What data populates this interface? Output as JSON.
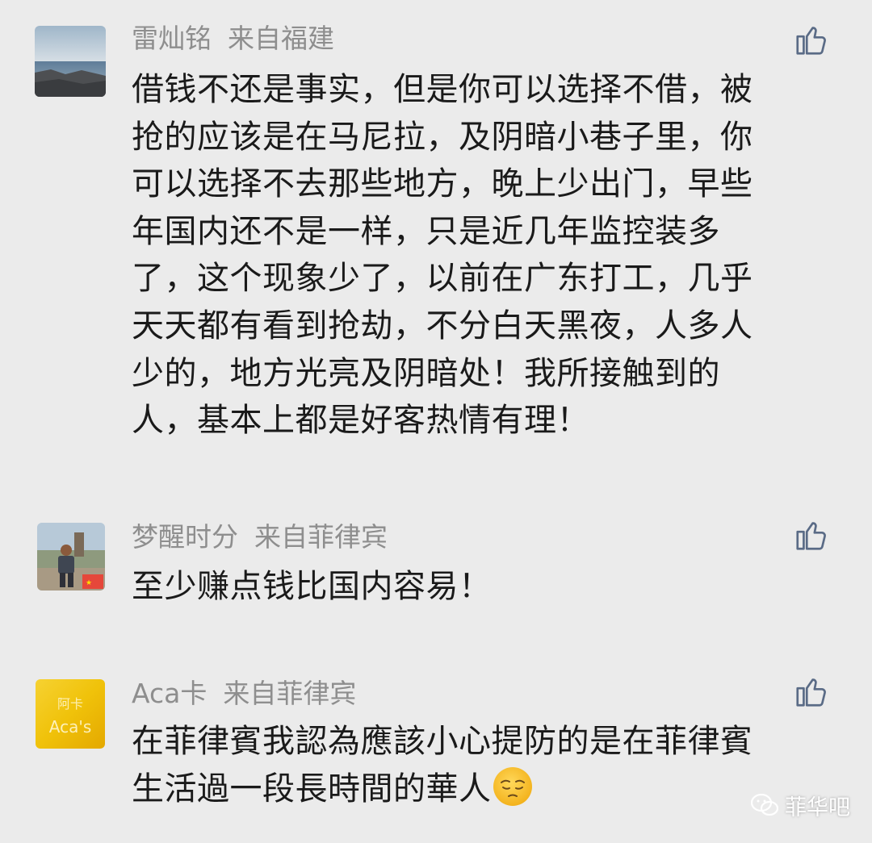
{
  "comments": [
    {
      "name": "雷灿铭",
      "location": "来自福建",
      "lines": [
        "借钱不还是事实，但是你可以选择不借，被",
        "抢的应该是在马尼拉，及阴暗小巷子里，你",
        "可以选择不去那些地方，晚上少出门，早些",
        "年国内还不是一样，只是近几年监控装多",
        "了，这个现象少了，以前在广东打工，几乎",
        "天天都有看到抢劫，不分白天黑夜，人多人",
        "少的，地方光亮及阴暗处！我所接触到的",
        "人，基本上都是好客热情有理！"
      ],
      "avatar_icon": "seaside-photo-avatar",
      "like_icon": "thumbs-up-icon"
    },
    {
      "name": "梦醒时分",
      "location": "来自菲律宾",
      "lines": [
        "至少赚点钱比国内容易！"
      ],
      "avatar_icon": "person-photo-avatar",
      "like_icon": "thumbs-up-icon"
    },
    {
      "name": "Aca卡",
      "location": "来自菲律宾",
      "lines": [
        "在菲律賓我認為應該小心提防的是在菲律賓",
        "生活過一段長時間的華人"
      ],
      "emoji": "pensive-face-emoji",
      "avatar_text_top": "阿卡",
      "avatar_text_bottom": "Aca's",
      "avatar_icon": "gold-text-avatar",
      "like_icon": "thumbs-up-icon"
    }
  ],
  "watermark": {
    "text": "菲华吧",
    "icon": "wechat-logo-icon"
  },
  "colors": {
    "background": "#ebebeb",
    "meta_text": "#8e8e8e",
    "body_text": "#1a1a1a",
    "like_icon": "#5a6b86"
  }
}
